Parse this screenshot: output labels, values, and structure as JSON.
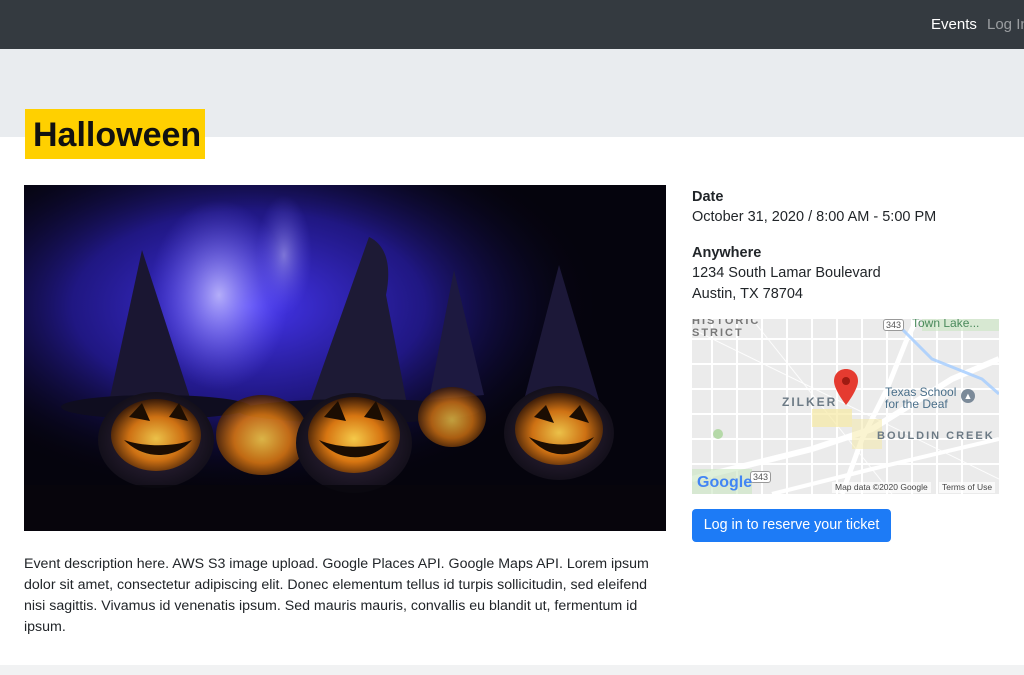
{
  "nav": {
    "links": [
      {
        "label": "Events"
      },
      {
        "label": "Log In"
      }
    ]
  },
  "event": {
    "title": "Halloween",
    "description": "Event description here. AWS S3 image upload. Google Places API. Google Maps API. Lorem ipsum dolor sit amet, consectetur adipiscing elit. Donec elementum tellus id turpis sollicitudin, sed eleifend nisi sagittis. Vivamus id venenatis ipsum. Sed mauris mauris, convallis eu blandit ut, fermentum id ipsum.",
    "date_label": "Date",
    "date_value": "October 31, 2020 / 8:00 AM - 5:00 PM",
    "venue_name": "Anywhere",
    "address_line1": "1234 South Lamar Boulevard",
    "address_line2": "Austin, TX 78704"
  },
  "map": {
    "labels": {
      "historic_district": "HISTORIC\nSTRICT",
      "zilker": "ZILKER",
      "bouldin_creek": "BOULDIN CREEK",
      "town_lake": "Town Lake...",
      "texas_school": "Texas School\nfor the Deaf",
      "road_343_top": "343",
      "road_343_bottom": "343",
      "map_data": "Map data ©2020 Google",
      "terms": "Terms of Use",
      "google_logo": "Google"
    },
    "icons": [
      "map-pin-icon",
      "school-icon"
    ],
    "pin_color": "#e53b30"
  },
  "actions": {
    "reserve_label": "Log in to reserve your ticket"
  },
  "colors": {
    "navbar": "#343a40",
    "title_highlight": "#ffd000",
    "primary": "#1d7bf6",
    "hero_band": "#e9ecef"
  }
}
